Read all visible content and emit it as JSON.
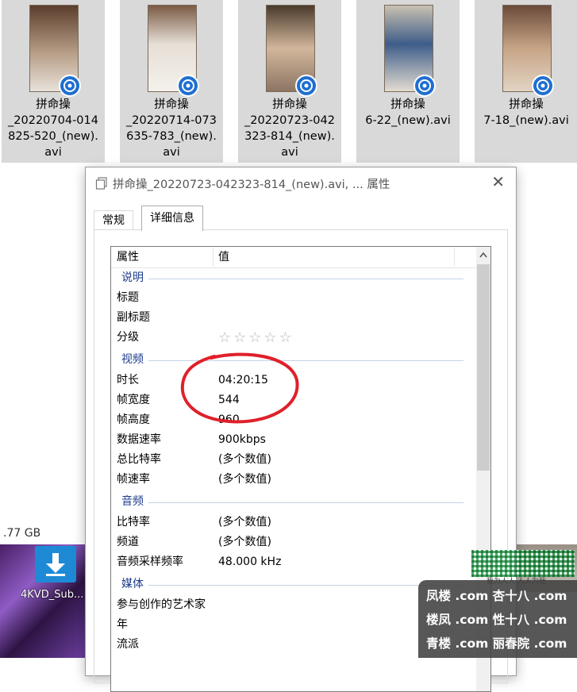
{
  "files": [
    {
      "name": "拼命操\n_20220704-014\n825-520_(new).\navi",
      "thumb_color": "#b79d86"
    },
    {
      "name": "拼命操\n_20220714-073\n635-783_(new).\navi",
      "thumb_color": "#e6dfd6"
    },
    {
      "name": "拼命操\n_20220723-042\n323-814_(new).\navi",
      "thumb_color": "#d2b79c"
    },
    {
      "name": "拼命操\n6-22_(new).avi",
      "thumb_color": "#3e5d8a"
    },
    {
      "name": "拼命操\n7-18_(new).avi",
      "thumb_color": "#c7a586"
    }
  ],
  "desktop": {
    "size_text": ".77 GB",
    "label": "4KVD_Sub..."
  },
  "dialog": {
    "title": "拼命操_20220723-042323-814_(new).avi, ... 属性",
    "tabs": {
      "general": "常规",
      "details": "详细信息"
    },
    "header": {
      "property": "属性",
      "value": "值"
    },
    "groups": {
      "description": "说明",
      "video": "视频",
      "audio": "音频",
      "media": "媒体"
    },
    "rows": {
      "title": {
        "k": "标题",
        "v": ""
      },
      "subtitle": {
        "k": "副标题",
        "v": ""
      },
      "rating": {
        "k": "分级",
        "stars": "☆☆☆☆☆",
        "rating_value": 0
      },
      "duration": {
        "k": "时长",
        "v": "04:20:15"
      },
      "frame_width": {
        "k": "帧宽度",
        "v": "544"
      },
      "frame_height": {
        "k": "帧高度",
        "v": "960"
      },
      "data_rate": {
        "k": "数据速率",
        "v": "900kbps"
      },
      "total_bitrate": {
        "k": "总比特率",
        "v": "(多个数值)"
      },
      "frame_rate": {
        "k": "帧速率",
        "v": "(多个数值)"
      },
      "bitrate": {
        "k": "比特率",
        "v": "(多个数值)"
      },
      "channels": {
        "k": "频道",
        "v": "(多个数值)"
      },
      "sample_rate": {
        "k": "音频采样频率",
        "v": "48.000 kHz"
      },
      "contributing_artist": {
        "k": "参与创作的艺术家",
        "v": ""
      },
      "year": {
        "k": "年",
        "v": ""
      },
      "genre": {
        "k": "流派",
        "v": ""
      }
    }
  },
  "watermark": {
    "caption": "我为人人 人人为我",
    "lines": [
      "凤楼 .com  杏十八 .com",
      "楼凤 .com  性十八 .com",
      "青楼 .com  丽春院 .com"
    ]
  },
  "colors": {
    "group_heading": "#1e3c8c",
    "annotation": "#e0202a",
    "badge": "#1f6fd1"
  }
}
